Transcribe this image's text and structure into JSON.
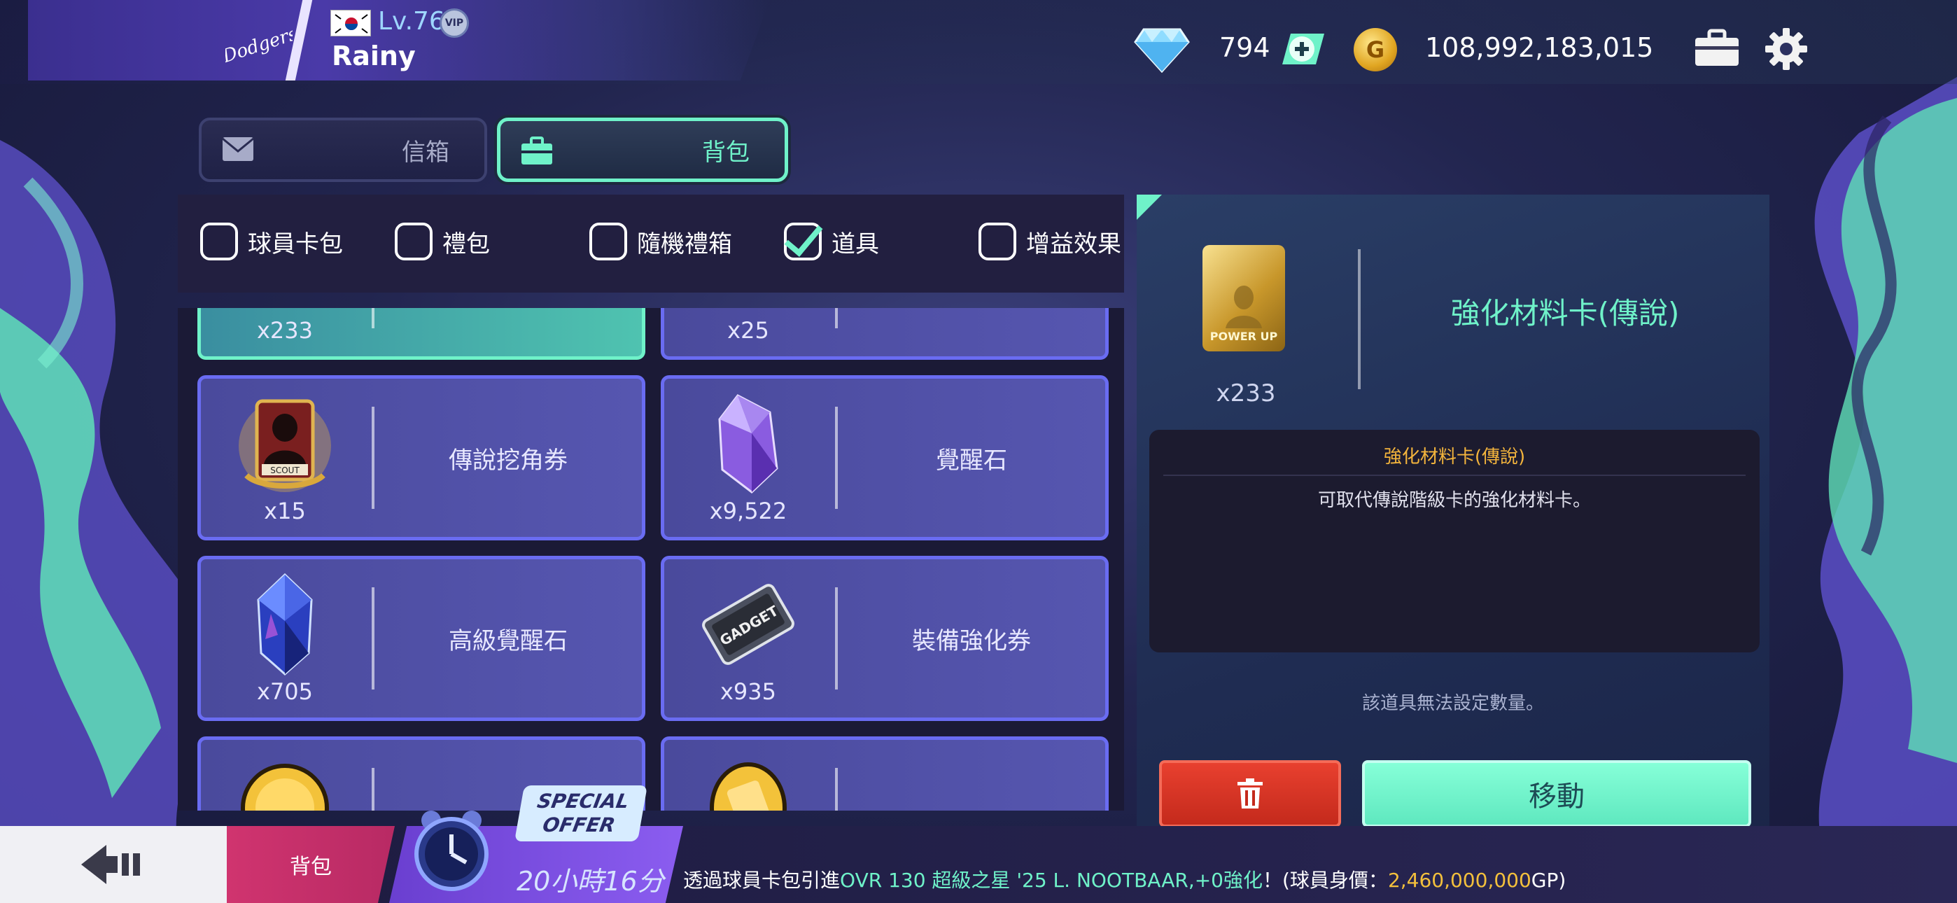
{
  "header": {
    "team_logo_text": "Dodgers",
    "level": "Lv.76",
    "vip_label": "VIP",
    "username": "Rainy",
    "gems": "794",
    "coins": "108,992,183,015",
    "coin_letter": "G"
  },
  "tabs": [
    {
      "label": "信箱",
      "active": false
    },
    {
      "label": "背包",
      "active": true
    }
  ],
  "filters": [
    {
      "label": "球員卡包",
      "checked": false
    },
    {
      "label": "禮包",
      "checked": false
    },
    {
      "label": "隨機禮箱",
      "checked": false
    },
    {
      "label": "道具",
      "checked": true
    },
    {
      "label": "增益效果",
      "checked": false
    }
  ],
  "items": [
    {
      "name": "",
      "qty": "x233",
      "selected": true
    },
    {
      "name": "",
      "qty": "x25",
      "selected": false
    },
    {
      "name": "傳說挖角券",
      "qty": "x15",
      "selected": false
    },
    {
      "name": "覺醒石",
      "qty": "x9,522",
      "selected": false
    },
    {
      "name": "高級覺醒石",
      "qty": "x705",
      "selected": false
    },
    {
      "name": "裝備強化券",
      "qty": "x935",
      "selected": false
    },
    {
      "name": "",
      "qty": "",
      "selected": false
    },
    {
      "name": "",
      "qty": "",
      "selected": false
    }
  ],
  "item_art_text": {
    "scout": "SCOUT",
    "gadget": "GADGET"
  },
  "detail": {
    "card_text": "POWER UP",
    "qty": "x233",
    "title": "強化材料卡(傳說)",
    "desc_head": "強化材料卡(傳說)",
    "desc_text": "可取代傳說階級卡的強化材料卡。",
    "note": "該道具無法設定數量。",
    "move_label": "移動"
  },
  "bottom": {
    "bag_label": "背包",
    "offer_line1": "SPECIAL",
    "offer_line2": "OFFER",
    "timer": "20小時16分",
    "ticker_pre": "透過球員卡包引進",
    "ticker_hl": "OVR 130 超級之星 '25 L. NOOTBAAR,+0強化",
    "ticker_mid": "！(球員身價：",
    "ticker_gold": "2,460,000,000",
    "ticker_post": "GP)"
  },
  "colors": {
    "accent": "#6ff2c9",
    "card_border": "#6a6cf2",
    "delete_red": "#d8321f",
    "gold_text": "#f3b43c"
  }
}
